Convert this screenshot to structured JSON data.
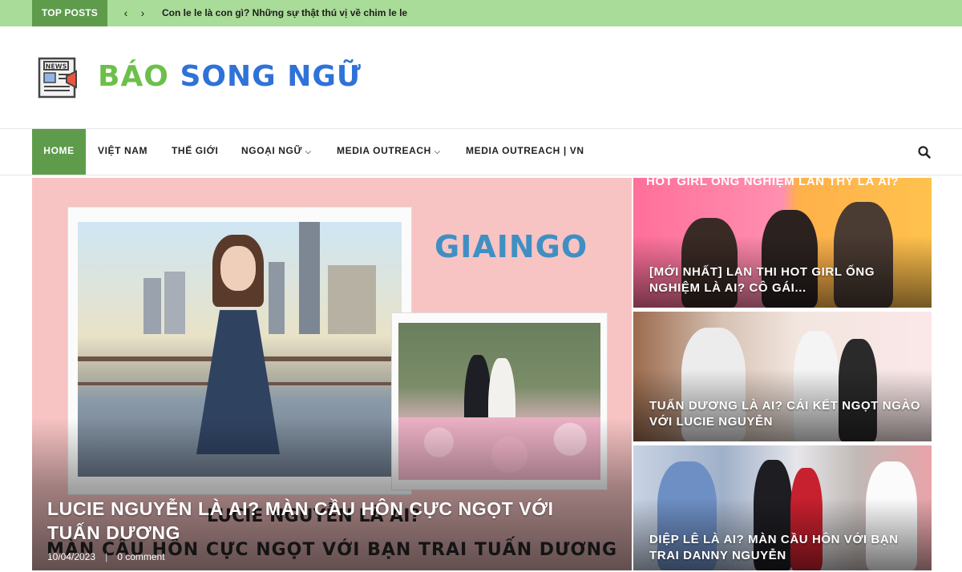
{
  "topbar": {
    "label": "TOP POSTS",
    "prev_icon": "‹",
    "next_icon": "›",
    "headline": "Con le le là con gì? Những sự thật thú vị về chim le le"
  },
  "header": {
    "logo_icon": "news-icon",
    "logo_word1": "BÁO",
    "logo_word2": "SONG NGỮ"
  },
  "nav": {
    "items": [
      {
        "label": "HOME"
      },
      {
        "label": "VIỆT NAM"
      },
      {
        "label": "THẾ GIỚI"
      },
      {
        "label": "NGOẠI NGỮ",
        "caret": "⌵"
      },
      {
        "label": "MEDIA OUTREACH",
        "caret": "⌵"
      },
      {
        "label": "MEDIA OUTREACH | VN"
      }
    ],
    "search_icon": "search-icon"
  },
  "hero": {
    "brand": "GIAINGO",
    "caption_line1": "LUCIE NGUYỄN LÀ AI?",
    "caption_line2": "MÀN CẦU HÔN CỰC NGỌT VỚI BẠN TRAI TUẤN DƯƠNG",
    "title": "LUCIE NGUYỄN LÀ AI? MÀN CẦU HÔN CỰC NGỌT VỚI TUẤN DƯƠNG",
    "date": "10/04/2023",
    "separator": "|",
    "comments": "0 comment"
  },
  "side_cards": [
    {
      "banner": "HOT GIRL ỐNG NGHIỆM LAN THY LÀ AI?",
      "title": "[MỚI NHẤT] LAN THI HOT GIRL ỐNG NGHIỆM LÀ AI? CÔ GÁI..."
    },
    {
      "title": "TUẤN DƯƠNG LÀ AI? CÁI KẾT NGỌT NGÀO VỚI LUCIE NGUYỄN"
    },
    {
      "title": "DIỆP LÊ LÀ AI? MÀN CẦU HÔN VỚI BẠN TRAI DANNY NGUYỄN"
    }
  ],
  "colors": {
    "topbar_bg": "#a9dc98",
    "accent_green": "#5e9c4c",
    "logo_green": "#6cc04a",
    "logo_blue": "#2f72d8",
    "hero_pink": "#f7c3c3"
  }
}
